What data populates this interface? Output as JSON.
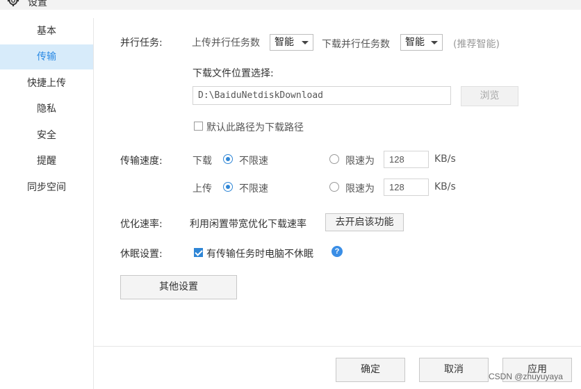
{
  "window": {
    "title": "设置",
    "icon": "gear-icon"
  },
  "sidebar": {
    "items": [
      {
        "label": "基本",
        "active": false
      },
      {
        "label": "传输",
        "active": true
      },
      {
        "label": "快捷上传",
        "active": false
      },
      {
        "label": "隐私",
        "active": false
      },
      {
        "label": "安全",
        "active": false
      },
      {
        "label": "提醒",
        "active": false
      },
      {
        "label": "同步空间",
        "active": false
      }
    ]
  },
  "parallel": {
    "label": "并行任务:",
    "upload_label": "上传并行任务数",
    "upload_value": "智能",
    "download_label": "下载并行任务数",
    "download_value": "智能",
    "hint": "(推荐智能)"
  },
  "download_location": {
    "label": "下载文件位置选择:",
    "path": "D:\\BaiduNetdiskDownload",
    "browse_label": "浏览",
    "default_checkbox_label": "默认此路径为下载路径",
    "default_checked": false
  },
  "speed": {
    "label": "传输速度:",
    "download": {
      "label": "下载",
      "unlimited_label": "不限速",
      "limit_label": "限速为",
      "limit_value": "128",
      "unit": "KB/s",
      "unlimited_selected": true
    },
    "upload": {
      "label": "上传",
      "unlimited_label": "不限速",
      "limit_label": "限速为",
      "limit_value": "128",
      "unit": "KB/s",
      "unlimited_selected": true
    }
  },
  "optimize": {
    "label": "优化速率:",
    "text": "利用闲置带宽优化下载速率",
    "button_label": "去开启该功能"
  },
  "sleep": {
    "label": "休眠设置:",
    "checkbox_label": "有传输任务时电脑不休眠",
    "checked": true,
    "help_icon": "question-icon",
    "help_glyph": "?"
  },
  "other_settings_label": "其他设置",
  "footer": {
    "ok_label": "确定",
    "cancel_label": "取消",
    "apply_label": "应用"
  },
  "watermark": "CSDN @zhuyuyaya",
  "colors": {
    "accent": "#2b8ae4",
    "active_bg": "#d7ebfa"
  }
}
